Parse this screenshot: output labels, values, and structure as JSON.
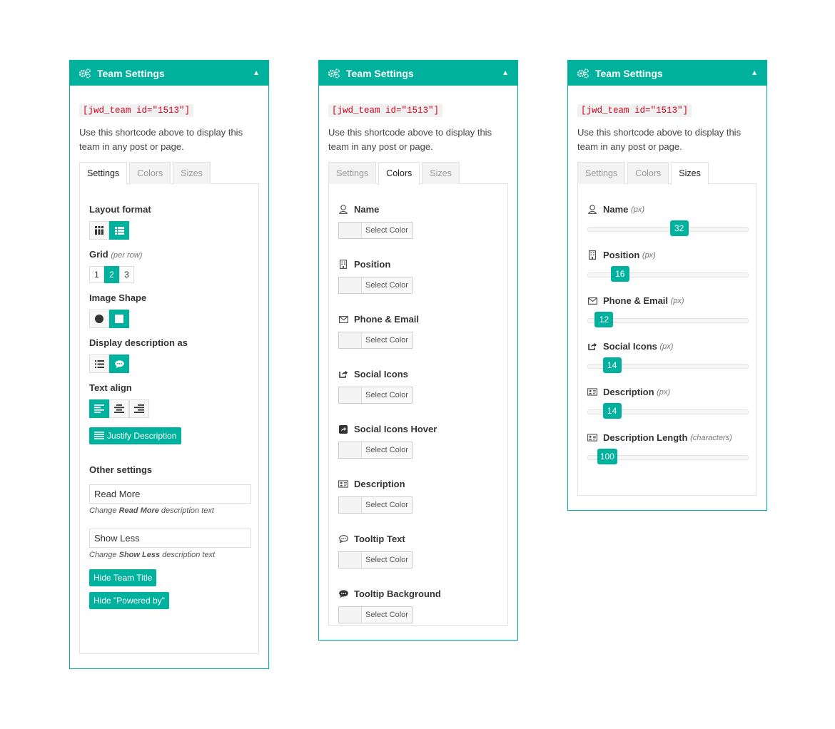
{
  "panel_title": "Team Settings",
  "shortcode": "[jwd_team id=\"1513\"]",
  "shortcode_help": "Use this shortcode above to display this team in any post or page.",
  "tabs": [
    "Settings",
    "Colors",
    "Sizes"
  ],
  "colors": {
    "accent": "#00b19d",
    "shortcode_text": "#d0021b"
  },
  "settings_tab": {
    "layout_format": {
      "label": "Layout format",
      "options": [
        "grid-icon",
        "list-icon"
      ],
      "selected": "list-icon"
    },
    "grid": {
      "label": "Grid",
      "hint": "(per row)",
      "options": [
        "1",
        "2",
        "3"
      ],
      "selected": "2"
    },
    "image_shape": {
      "label": "Image Shape",
      "options": [
        "circle-icon",
        "square-icon"
      ],
      "selected": "square-icon"
    },
    "display_description": {
      "label": "Display description as",
      "options": [
        "list-icon",
        "comment-icon"
      ],
      "selected": "comment-icon"
    },
    "text_align": {
      "label": "Text align",
      "options": [
        "align-left-icon",
        "align-center-icon",
        "align-right-icon"
      ],
      "selected": "align-left-icon"
    },
    "justify_button": "Justify Description",
    "other_settings_label": "Other settings",
    "read_more": {
      "value": "Read More",
      "help_prefix": "Change",
      "help_bold": "Read More",
      "help_suffix": "description text"
    },
    "show_less": {
      "value": "Show Less",
      "help_prefix": "Change",
      "help_bold": "Show Less",
      "help_suffix": "description text"
    },
    "hide_title_button": "Hide Team Title",
    "hide_powered_button": "Hide \"Powered by\""
  },
  "colors_tab": {
    "picker_label": "Select Color",
    "items": [
      {
        "label": "Name",
        "icon": "user-icon"
      },
      {
        "label": "Position",
        "icon": "building-icon"
      },
      {
        "label": "Phone & Email",
        "icon": "envelope-icon"
      },
      {
        "label": "Social Icons",
        "icon": "share-icon"
      },
      {
        "label": "Social Icons Hover",
        "icon": "share-square-icon"
      },
      {
        "label": "Description",
        "icon": "id-card-icon"
      },
      {
        "label": "Tooltip Text",
        "icon": "comment-outline-icon"
      },
      {
        "label": "Tooltip Background",
        "icon": "comment-solid-icon"
      }
    ]
  },
  "sizes_tab": {
    "items": [
      {
        "label": "Name",
        "unit": "(px)",
        "icon": "user-icon",
        "value": "32",
        "fraction": 0.57
      },
      {
        "label": "Position",
        "unit": "(px)",
        "icon": "building-icon",
        "value": "16",
        "fraction": 0.2
      },
      {
        "label": "Phone & Email",
        "unit": "(px)",
        "icon": "envelope-icon",
        "value": "12",
        "fraction": 0.1
      },
      {
        "label": "Social Icons",
        "unit": "(px)",
        "icon": "share-icon",
        "value": "14",
        "fraction": 0.15
      },
      {
        "label": "Description",
        "unit": "(px)",
        "icon": "id-card-icon",
        "value": "14",
        "fraction": 0.15
      },
      {
        "label": "Description Length",
        "unit": "(characters)",
        "icon": "id-card-icon",
        "value": "100",
        "fraction": 0.12
      }
    ]
  }
}
